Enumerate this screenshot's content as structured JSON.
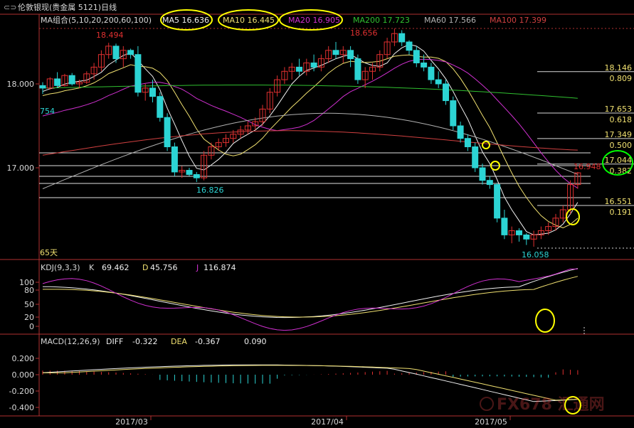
{
  "window": {
    "title": "伦敦银现(贵金属 5121)日线"
  },
  "colors": {
    "up": "#e03030",
    "down": "#2cd4d4",
    "ma5": "#f0f0f0",
    "ma10": "#f0e070",
    "ma20": "#d030d0",
    "ma200": "#30c030",
    "ma60": "#b0b0b0",
    "ma100": "#d04040",
    "axis": "#b03030",
    "grid_dot": "#b03030",
    "fib_line": "#e0e0e0",
    "highlight": "#ffff00",
    "highlight_green": "#00ff00"
  },
  "main_panel": {
    "legend": [
      {
        "label": "MA组合(5,10,20,200,60,100)",
        "color": "#d8d8d8"
      },
      {
        "label": "MA5 16.636",
        "color": "#f0f0f0"
      },
      {
        "label": "MA10 16.445",
        "color": "#f0e070"
      },
      {
        "label": "MA20 16.905",
        "color": "#d030d0"
      },
      {
        "label": "MA200 17.723",
        "color": "#30c030"
      },
      {
        "label": "MA60 17.566",
        "color": "#b0b0b0"
      },
      {
        "label": "MA100 17.399",
        "color": "#d04040"
      }
    ],
    "y_ticks": [
      "18.000",
      "17.000"
    ],
    "annotations": {
      "high1": "18.494",
      "high2": "18.656",
      "low1": "16.826",
      "low2": "16.058",
      "left_edge": "754",
      "bottom_left": "65天",
      "last_price": "16.948"
    },
    "fib_levels": [
      {
        "price": "18.146",
        "ratio": "0.809"
      },
      {
        "price": "17.653",
        "ratio": "0.618"
      },
      {
        "price": "17.349",
        "ratio": "0.500"
      },
      {
        "price": "17.044",
        "ratio": "0.382"
      },
      {
        "price": "16.551",
        "ratio": "0.191"
      }
    ]
  },
  "kdj_panel": {
    "legend": [
      {
        "label": "KDJ(9,3,3)",
        "color": "#d8d8d8"
      },
      {
        "label": "K",
        "color": "#d8d8d8"
      },
      {
        "label": "69.462",
        "color": "#f0f0f0"
      },
      {
        "label": "D",
        "color": "#f0e070"
      },
      {
        "label": "45.756",
        "color": "#f0f0f0"
      },
      {
        "label": "J",
        "color": "#d030d0"
      },
      {
        "label": "116.874",
        "color": "#f0f0f0"
      }
    ],
    "y_ticks": [
      "100",
      "80",
      "50",
      "20",
      "0"
    ]
  },
  "macd_panel": {
    "legend": [
      {
        "label": "MACD(12,26,9)",
        "color": "#d8d8d8"
      },
      {
        "label": "DIFF",
        "color": "#f0f0f0"
      },
      {
        "label": "-0.322",
        "color": "#f0f0f0"
      },
      {
        "label": "DEA",
        "color": "#f0e070"
      },
      {
        "label": "-0.367",
        "color": "#f0f0f0"
      },
      {
        "label": "0.090",
        "color": "#f0f0f0"
      }
    ],
    "y_ticks": [
      "0.200",
      "0.000",
      "-0.200",
      "-0.400"
    ]
  },
  "x_axis": {
    "labels": [
      "2017/03",
      "2017/04",
      "2017/05"
    ]
  },
  "watermark": {
    "text": "FX678 汇通网"
  },
  "chart_data": {
    "type": "candlestick",
    "title": "伦敦银现(贵金属 5121)日线",
    "ylim": [
      15.9,
      18.85
    ],
    "candles": [
      [
        17.98,
        18.02,
        17.88,
        17.95
      ],
      [
        17.95,
        18.08,
        17.93,
        18.06
      ],
      [
        18.06,
        18.14,
        17.95,
        17.98
      ],
      [
        17.98,
        18.12,
        17.97,
        18.1
      ],
      [
        18.1,
        18.13,
        17.98,
        18.0
      ],
      [
        18.0,
        18.05,
        17.95,
        18.02
      ],
      [
        18.02,
        18.15,
        18.0,
        18.12
      ],
      [
        18.12,
        18.25,
        18.05,
        18.2
      ],
      [
        18.2,
        18.4,
        18.15,
        18.35
      ],
      [
        18.35,
        18.49,
        18.3,
        18.45
      ],
      [
        18.45,
        18.48,
        18.25,
        18.3
      ],
      [
        18.3,
        18.45,
        18.2,
        18.4
      ],
      [
        18.4,
        18.42,
        18.3,
        18.35
      ],
      [
        18.35,
        18.45,
        17.85,
        17.9
      ],
      [
        17.9,
        18.0,
        17.8,
        17.95
      ],
      [
        17.95,
        18.05,
        17.78,
        17.85
      ],
      [
        17.85,
        17.9,
        17.55,
        17.6
      ],
      [
        17.6,
        17.65,
        17.2,
        17.25
      ],
      [
        17.25,
        17.3,
        16.9,
        16.95
      ],
      [
        16.95,
        17.02,
        16.88,
        16.97
      ],
      [
        16.97,
        17.0,
        16.9,
        16.92
      ],
      [
        16.92,
        16.95,
        16.83,
        16.88
      ],
      [
        16.88,
        17.2,
        16.85,
        17.15
      ],
      [
        17.15,
        17.3,
        17.1,
        17.25
      ],
      [
        17.25,
        17.35,
        17.2,
        17.3
      ],
      [
        17.3,
        17.4,
        17.25,
        17.35
      ],
      [
        17.35,
        17.45,
        17.3,
        17.4
      ],
      [
        17.4,
        17.5,
        17.35,
        17.45
      ],
      [
        17.45,
        17.55,
        17.4,
        17.5
      ],
      [
        17.5,
        17.6,
        17.45,
        17.55
      ],
      [
        17.55,
        17.75,
        17.5,
        17.7
      ],
      [
        17.7,
        17.95,
        17.65,
        17.9
      ],
      [
        17.9,
        18.1,
        17.85,
        18.05
      ],
      [
        18.05,
        18.2,
        18.0,
        18.15
      ],
      [
        18.15,
        18.25,
        18.05,
        18.2
      ],
      [
        18.2,
        18.3,
        18.1,
        18.15
      ],
      [
        18.15,
        18.3,
        18.1,
        18.25
      ],
      [
        18.25,
        18.35,
        18.15,
        18.2
      ],
      [
        18.2,
        18.35,
        18.15,
        18.3
      ],
      [
        18.3,
        18.45,
        18.25,
        18.4
      ],
      [
        18.4,
        18.5,
        18.3,
        18.35
      ],
      [
        18.35,
        18.45,
        18.25,
        18.4
      ],
      [
        18.4,
        18.45,
        18.2,
        18.3
      ],
      [
        18.3,
        18.35,
        18.0,
        18.05
      ],
      [
        18.05,
        18.2,
        17.95,
        18.15
      ],
      [
        18.15,
        18.25,
        18.05,
        18.2
      ],
      [
        18.2,
        18.4,
        18.15,
        18.35
      ],
      [
        18.35,
        18.55,
        18.3,
        18.5
      ],
      [
        18.5,
        18.66,
        18.45,
        18.6
      ],
      [
        18.6,
        18.64,
        18.45,
        18.5
      ],
      [
        18.5,
        18.52,
        18.35,
        18.4
      ],
      [
        18.4,
        18.45,
        18.2,
        18.25
      ],
      [
        18.25,
        18.35,
        18.15,
        18.2
      ],
      [
        18.2,
        18.25,
        18.0,
        18.05
      ],
      [
        18.05,
        18.15,
        17.95,
        18.0
      ],
      [
        18.0,
        18.05,
        17.75,
        17.8
      ],
      [
        17.8,
        17.85,
        17.45,
        17.5
      ],
      [
        17.5,
        17.55,
        17.3,
        17.35
      ],
      [
        17.35,
        17.4,
        17.2,
        17.25
      ],
      [
        17.25,
        17.3,
        16.95,
        17.0
      ],
      [
        17.0,
        17.05,
        16.8,
        16.85
      ],
      [
        16.85,
        16.9,
        16.75,
        16.8
      ],
      [
        16.8,
        16.82,
        16.35,
        16.4
      ],
      [
        16.4,
        16.5,
        16.15,
        16.2
      ],
      [
        16.2,
        16.3,
        16.1,
        16.25
      ],
      [
        16.25,
        16.28,
        16.12,
        16.2
      ],
      [
        16.2,
        16.22,
        16.08,
        16.15
      ],
      [
        16.15,
        16.25,
        16.06,
        16.2
      ],
      [
        16.2,
        16.3,
        16.15,
        16.25
      ],
      [
        16.25,
        16.35,
        16.2,
        16.3
      ],
      [
        16.3,
        16.45,
        16.25,
        16.4
      ],
      [
        16.4,
        16.55,
        16.35,
        16.5
      ],
      [
        16.5,
        16.85,
        16.45,
        16.8
      ],
      [
        16.8,
        16.95,
        16.75,
        16.94
      ]
    ],
    "fib_prices": [
      18.146,
      17.653,
      17.349,
      17.044,
      16.551
    ]
  }
}
